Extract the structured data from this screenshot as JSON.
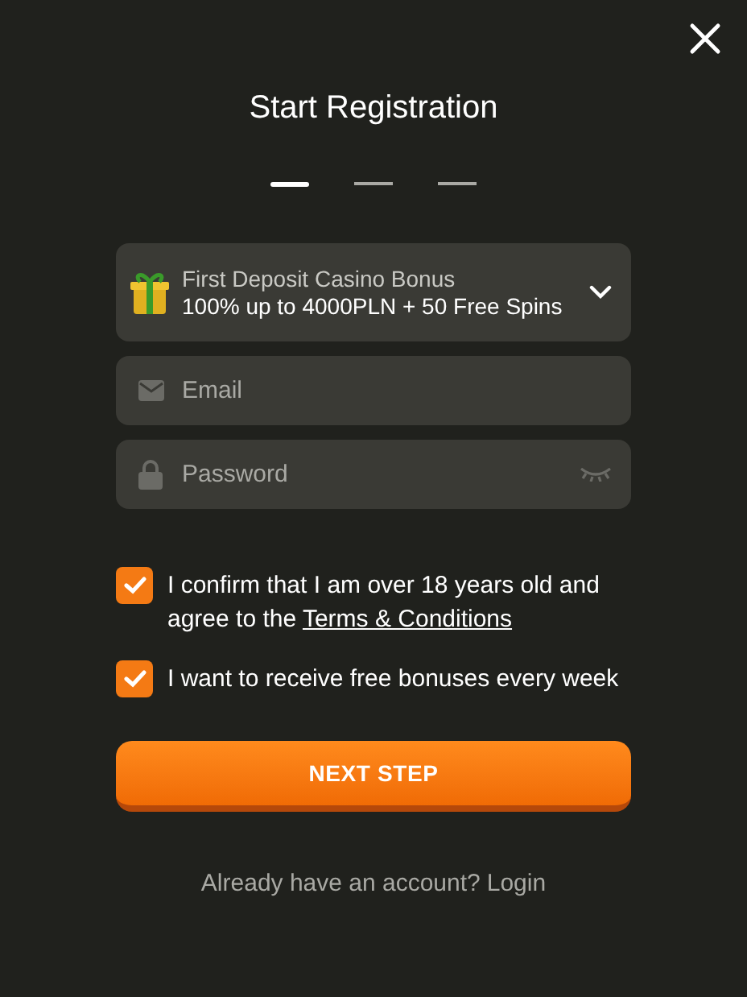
{
  "title": "Start Registration",
  "steps": [
    {
      "selected": true
    },
    {
      "selected": false
    },
    {
      "selected": false
    }
  ],
  "bonus": {
    "title": "First Deposit Casino Bonus",
    "offer": "100% up to 4000PLN + 50 Free Spins"
  },
  "email": {
    "placeholder": "Email"
  },
  "password": {
    "placeholder": "Password"
  },
  "consents": [
    {
      "text": "I confirm that I am over 18 years old and agree to the ",
      "link": "Terms & Conditions",
      "checked": true
    },
    {
      "text": "I want to receive free bonuses every week",
      "checked": true
    }
  ],
  "button": "NEXT STEP",
  "footer": {
    "text": "Already have an account?",
    "link": "Login"
  }
}
